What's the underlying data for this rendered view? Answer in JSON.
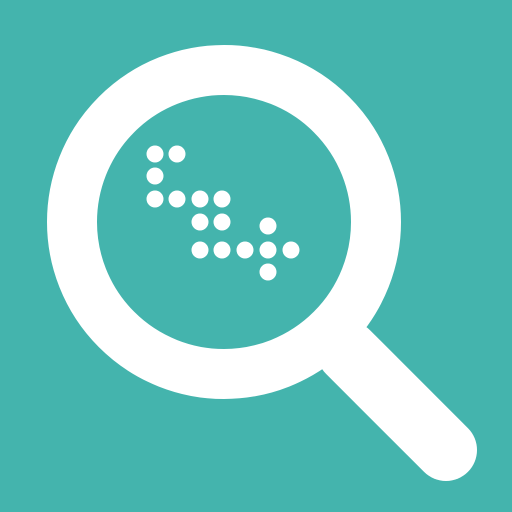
{
  "icon": {
    "name": "magnifying-glass-with-dot-pattern",
    "background_color": "#44b4ad",
    "foreground_color": "#ffffff"
  }
}
